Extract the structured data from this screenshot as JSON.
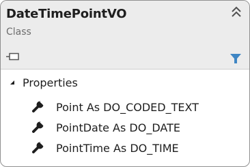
{
  "class_shape": {
    "name": "DateTimePointVO",
    "kind": "Class",
    "icons": {
      "collapse": "double-chevron-up-icon",
      "class": "class-icon",
      "filter": "filter-icon"
    },
    "colors": {
      "header_background": "#ececec",
      "filter_icon": "#3f86c4",
      "member_icon": "#1e1e1e"
    }
  },
  "compartments": [
    {
      "label": "Properties",
      "expanded": true,
      "icon": "expanded-triangle-icon",
      "members": [
        {
          "label": "Point As DO_CODED_TEXT",
          "icon": "wrench-icon"
        },
        {
          "label": "PointDate As DO_DATE",
          "icon": "wrench-icon"
        },
        {
          "label": "PointTime As DO_TIME",
          "icon": "wrench-icon"
        }
      ]
    }
  ]
}
